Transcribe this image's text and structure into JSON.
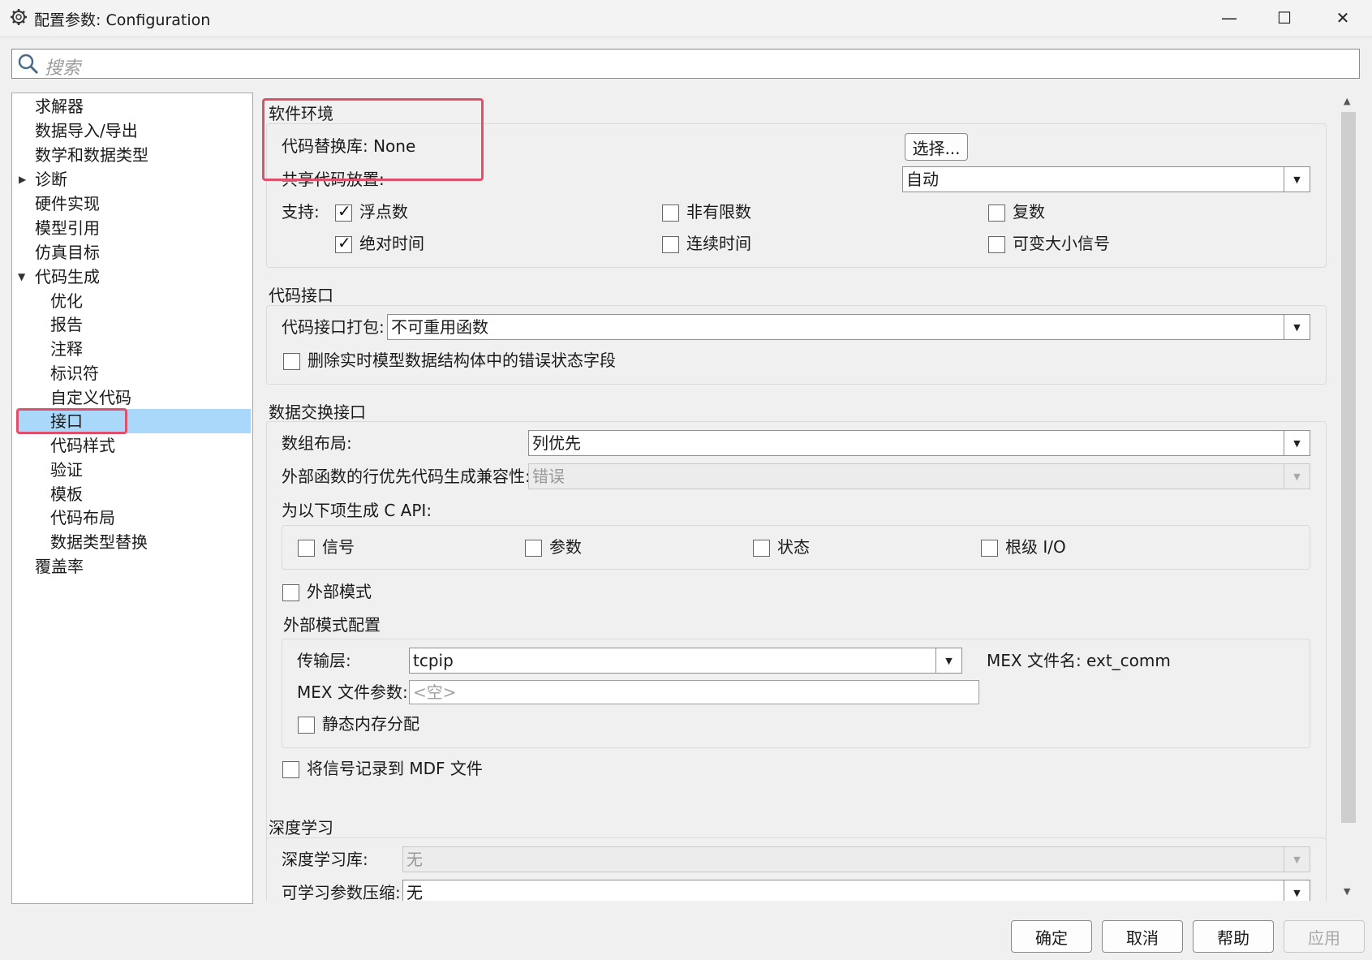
{
  "window": {
    "title": "配置参数: Configuration",
    "minimize": "—",
    "maximize": "☐",
    "close": "✕"
  },
  "search": {
    "placeholder": "搜索"
  },
  "tree": {
    "items": [
      {
        "label": "求解器"
      },
      {
        "label": "数据导入/导出"
      },
      {
        "label": "数学和数据类型"
      },
      {
        "label": "诊断"
      },
      {
        "label": "硬件实现"
      },
      {
        "label": "模型引用"
      },
      {
        "label": "仿真目标"
      },
      {
        "label": "代码生成"
      },
      {
        "label": "优化"
      },
      {
        "label": "报告"
      },
      {
        "label": "注释"
      },
      {
        "label": "标识符"
      },
      {
        "label": "自定义代码"
      },
      {
        "label": "接口"
      },
      {
        "label": "代码样式"
      },
      {
        "label": "验证"
      },
      {
        "label": "模板"
      },
      {
        "label": "代码布局"
      },
      {
        "label": "数据类型替换"
      },
      {
        "label": "覆盖率"
      }
    ]
  },
  "software_env": {
    "title": "软件环境",
    "code_replacement_label": "代码替换库: None",
    "select_button": "选择...",
    "shared_code_label": "共享代码放置:",
    "shared_code_value": "自动",
    "support_label": "支持:",
    "support": [
      {
        "label": "浮点数",
        "checked": true
      },
      {
        "label": "非有限数",
        "checked": false
      },
      {
        "label": "复数",
        "checked": false
      },
      {
        "label": "绝对时间",
        "checked": true
      },
      {
        "label": "连续时间",
        "checked": false
      },
      {
        "label": "可变大小信号",
        "checked": false
      }
    ]
  },
  "code_interface": {
    "title": "代码接口",
    "packaging_label": "代码接口打包:",
    "packaging_value": "不可重用函数",
    "remove_error_label": "删除实时模型数据结构体中的错误状态字段"
  },
  "data_exchange": {
    "title": "数据交换接口",
    "array_layout_label": "数组布局:",
    "array_layout_value": "列优先",
    "row_major_label": "外部函数的行优先代码生成兼容性:",
    "row_major_value": "错误",
    "capi_label": "为以下项生成 C API:",
    "capi": [
      {
        "label": "信号"
      },
      {
        "label": "参数"
      },
      {
        "label": "状态"
      },
      {
        "label": "根级 I/O"
      }
    ],
    "external_mode_label": "外部模式",
    "ext_config_title": "外部模式配置",
    "transport_label": "传输层:",
    "transport_value": "tcpip",
    "mex_name_label": "MEX 文件名: ext_comm",
    "mex_args_label": "MEX 文件参数:",
    "mex_args_placeholder": "<空>",
    "static_mem_label": "静态内存分配",
    "mdf_label": "将信号记录到 MDF 文件"
  },
  "deep_learning": {
    "title": "深度学习",
    "library_label": "深度学习库:",
    "library_value": "无",
    "compression_label": "可学习参数压缩:",
    "compression_value": "无"
  },
  "footer": {
    "ok": "确定",
    "cancel": "取消",
    "help": "帮助",
    "apply": "应用"
  },
  "colors": {
    "selection": "#a9d8fa",
    "highlight_box": "#e0506a"
  }
}
